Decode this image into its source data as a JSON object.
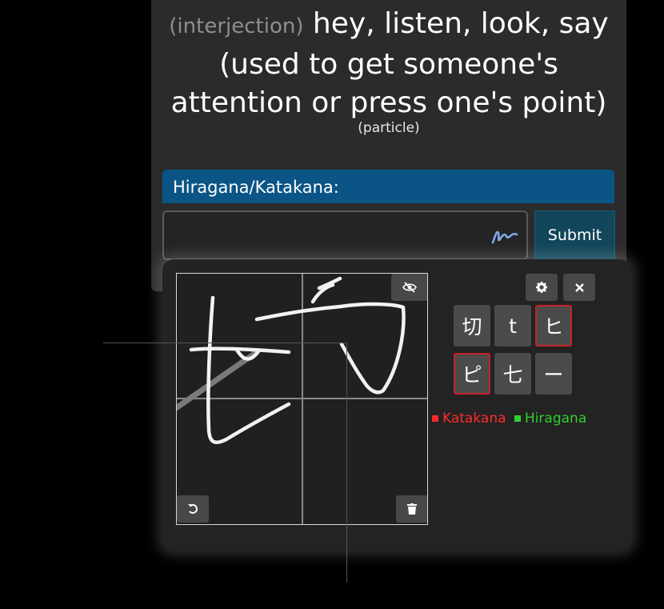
{
  "card": {
    "part_of_speech": "(interjection)",
    "meaning": "hey, listen, look, say (used to get someone's attention or press one's point)",
    "sub_pos": "(particle)",
    "label": "Hiragana/Katakana:",
    "input_value": "",
    "submit_label": "Submit"
  },
  "candidates": [
    {
      "char": "切",
      "script": "kanji"
    },
    {
      "char": "t",
      "script": "latin"
    },
    {
      "char": "ヒ",
      "script": "katakana"
    },
    {
      "char": "ピ",
      "script": "katakana"
    },
    {
      "char": "七",
      "script": "kanji"
    },
    {
      "char": "ー",
      "script": "katakana"
    }
  ],
  "legend": {
    "katakana": "Katakana",
    "hiragana": "Hiragana"
  },
  "colors": {
    "katakana": "#ff2a2a",
    "hiragana": "#2fcf2f",
    "label_bar": "#0b5586",
    "submit": "#12475b"
  },
  "icons": {
    "input": "handwriting-pen-icon",
    "hide": "eye-slash-icon",
    "undo": "undo-icon",
    "clear": "trash-icon",
    "settings": "gear-icon",
    "close": "close-icon"
  }
}
